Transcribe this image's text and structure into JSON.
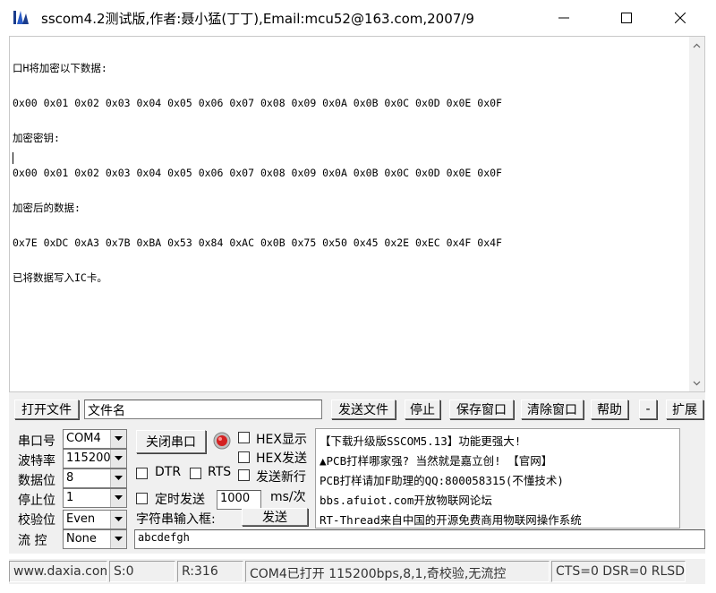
{
  "window": {
    "title": "sscom4.2测试版,作者:聂小猛(丁丁),Email:mcu52@163.com,2007/9"
  },
  "receive": {
    "lines": [
      "口H将加密以下数据:",
      "0x00 0x01 0x02 0x03 0x04 0x05 0x06 0x07 0x08 0x09 0x0A 0x0B 0x0C 0x0D 0x0E 0x0F",
      "加密密钥:",
      "0x00 0x01 0x02 0x03 0x04 0x05 0x06 0x07 0x08 0x09 0x0A 0x0B 0x0C 0x0D 0x0E 0x0F",
      "加密后的数据:",
      "0x7E 0xDC 0xA3 0x7B 0xBA 0x53 0x84 0xAC 0x0B 0x75 0x50 0x45 0x2E 0xEC 0x4F 0x4F",
      "已将数据写入IC卡。"
    ]
  },
  "toolbar": {
    "open_file": "打开文件",
    "filename": "文件名",
    "send_file": "发送文件",
    "stop": "停止",
    "save_window": "保存窗口",
    "clear_window": "清除窗口",
    "help": "帮助",
    "minus": "-",
    "expand": "扩展"
  },
  "settings": {
    "port_label": "串口号",
    "port_value": "COM4",
    "baud_label": "波特率",
    "baud_value": "115200",
    "databits_label": "数据位",
    "databits_value": "8",
    "stopbits_label": "停止位",
    "stopbits_value": "1",
    "parity_label": "校验位",
    "parity_value": "Even",
    "flow_label": "流 控",
    "flow_value": "None"
  },
  "controls": {
    "close_port": "关闭串口",
    "hex_display": "HEX显示",
    "hex_send": "HEX发送",
    "dtr": "DTR",
    "rts": "RTS",
    "send_newline": "发送新行",
    "timed_send": "定时发送",
    "interval": "1000",
    "interval_unit": "ms/次",
    "input_label": "字符串输入框:",
    "send": "发送",
    "input_value": "abcdefgh"
  },
  "info": {
    "lines": [
      "【下载升级版SSCOM5.13】功能更强大!",
      "▲PCB打样哪家强? 当然就是嘉立创! 【官网】",
      "PCB打样请加F助理的QQ:800058315(不懂技术)",
      "bbs.afuiot.com开放物联网论坛",
      "RT-Thread来自中国的开源免费商用物联网操作系统"
    ]
  },
  "status": {
    "website": "www.daxia.com",
    "sent": "S:0",
    "received": "R:316",
    "port_state": "COM4已打开  115200bps,8,1,奇校验,无流控",
    "signals": "CTS=0 DSR=0 RLSD"
  },
  "colors": {
    "panel_bg": "#f0f0f0",
    "led_red": "#d42020"
  }
}
